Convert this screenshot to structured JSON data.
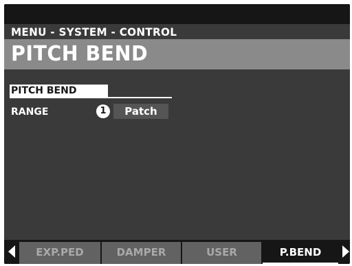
{
  "header": {
    "breadcrumb": "MENU - SYSTEM - CONTROL",
    "title": "PITCH BEND"
  },
  "parameters": {
    "section_label": "PITCH BEND",
    "range_label": "RANGE",
    "range_index": "1",
    "range_value": "Patch"
  },
  "tabs": [
    {
      "label": "EXP.PED",
      "active": false
    },
    {
      "label": "DAMPER",
      "active": false
    },
    {
      "label": "USER",
      "active": false
    },
    {
      "label": "P.BEND",
      "active": true
    }
  ],
  "icons": {
    "prev": "triangle-left-icon",
    "next": "triangle-right-icon"
  },
  "colors": {
    "screen_bg": "#3a3a3a",
    "title_bar": "#8a8a8a",
    "tab_inactive": "#626262",
    "text": "#ffffff"
  }
}
